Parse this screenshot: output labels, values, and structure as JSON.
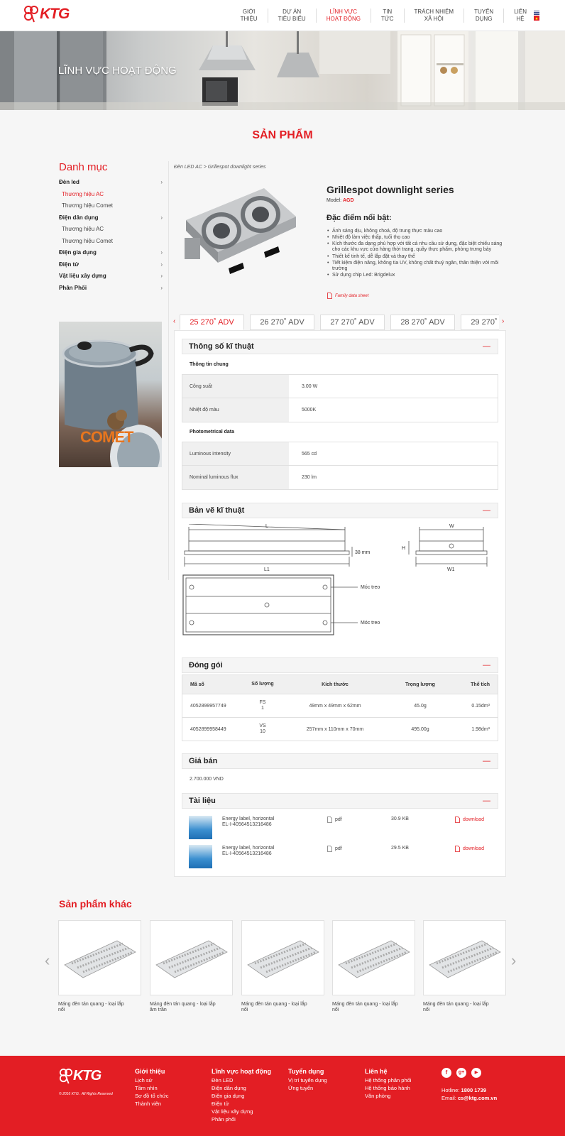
{
  "header": {
    "logo_text": "KTG",
    "nav": [
      {
        "l1": "GIỚI",
        "l2": "THIỆU"
      },
      {
        "l1": "DỰ ÁN",
        "l2": "TIÊU BIỂU"
      },
      {
        "l1": "LĨNH VỰC",
        "l2": "HOẠT ĐỘNG"
      },
      {
        "l1": "TIN",
        "l2": "TỨC"
      },
      {
        "l1": "TRÁCH NHIỆM",
        "l2": "XÃ HỘI"
      },
      {
        "l1": "TUYỂN",
        "l2": "DỤNG"
      },
      {
        "l1": "LIÊN",
        "l2": "HỆ"
      }
    ]
  },
  "hero": {
    "title": "LĨNH VỰC HOẠT ĐỘNG"
  },
  "section_title": "SẢN PHẨM",
  "sidebar": {
    "title": "Danh mục",
    "items": [
      {
        "label": "Đèn led",
        "type": "cat"
      },
      {
        "label": "Thương hiệu AC",
        "type": "sub",
        "active": true
      },
      {
        "label": "Thương hiệu Comet",
        "type": "sub"
      },
      {
        "label": "Điện dân dụng",
        "type": "cat"
      },
      {
        "label": "Thương hiệu AC",
        "type": "sub"
      },
      {
        "label": "Thương hiệu Comet",
        "type": "sub"
      },
      {
        "label": "Điện gia dụng",
        "type": "cat"
      },
      {
        "label": "Điện tử",
        "type": "cat"
      },
      {
        "label": "Vật liệu xây dựng",
        "type": "cat"
      },
      {
        "label": "Phân Phối",
        "type": "cat"
      }
    ],
    "promo_brand": "COMET"
  },
  "product": {
    "breadcrumb": "Đèn LED AC > Grillespot downlight series",
    "title": "Grillespot downlight series",
    "model_label": "Model:",
    "model_value": "AGD",
    "features_title": "Đặc điểm nổi bật:",
    "features": [
      "Ánh sáng dịu, không choá, độ trung thực màu cao",
      "Nhiệt độ làm việc thấp, tuổi thọ cao",
      "Kích thước đa dạng phù hợp với tất cả nhu cầu sử dụng, đặc biệt chiếu sáng cho các khu vực cửa hàng thời trang, quầy thực phẩm, phòng trưng bày",
      "Thiết kế tinh tế, dễ lắp đặt và thay thế",
      "Tiết kiệm điện năng, không tia UV, không chất thuỷ ngân, thân thiện với môi trường",
      "Sử dụng chip Led: Brigdelux"
    ],
    "datasheet_label": "Family data sheet"
  },
  "tabs": [
    {
      "label": "25 270˚ ADV",
      "active": true
    },
    {
      "label": "26 270˚ ADV"
    },
    {
      "label": "27 270˚ ADV"
    },
    {
      "label": "28 270˚ ADV"
    },
    {
      "label": "29 270˚ ADV"
    }
  ],
  "specs": {
    "title": "Thông số kĩ thuật",
    "general_title": "Thông tin chung",
    "general": [
      {
        "k": "Công suất",
        "v": "3.00 W"
      },
      {
        "k": "Nhiệt độ màu",
        "v": "5000K"
      }
    ],
    "photo_title": "Photometrical data",
    "photo": [
      {
        "k": "Luminous intensity",
        "v": "565 cd"
      },
      {
        "k": "Nominal luminous flux",
        "v": "230 lm"
      }
    ]
  },
  "drawing": {
    "title": "Bản vẽ kĩ thuật",
    "label_L": "L",
    "label_L1": "L1",
    "label_38": "38 mm",
    "label_W": "W",
    "label_W1": "W1",
    "label_H": "H",
    "label_hook1": "Móc treo",
    "label_hook2": "Móc treo"
  },
  "packaging": {
    "title": "Đóng gói",
    "headers": [
      "Mã số",
      "Số lượng",
      "Kích thước",
      "Trọng lượng",
      "Thể tích"
    ],
    "rows": [
      {
        "code": "4052899957749",
        "qty_unit": "FS",
        "qty": "1",
        "size": "49mm x 49mm x 62mm",
        "weight": "45.0g",
        "volume": "0.15dm³"
      },
      {
        "code": "4052899958449",
        "qty_unit": "VS",
        "qty": "10",
        "size": "257mm x 110mm x 70mm",
        "weight": "495.00g",
        "volume": "1.98dm³"
      }
    ]
  },
  "price": {
    "title": "Giá bán",
    "value": "2.700.000 VND"
  },
  "documents": {
    "title": "Tài liệu",
    "items": [
      {
        "line1": "Energy label, horizontal",
        "line2": "EL-I-40564513216486",
        "type": "pdf",
        "size": "30.9 KB",
        "download": "download"
      },
      {
        "line1": "Energy label, horizontal",
        "line2": "EL-I-40564513216486",
        "type": "pdf",
        "size": "29.5 KB",
        "download": "download"
      }
    ]
  },
  "other": {
    "title": "Sản phẩm khác",
    "items": [
      {
        "l1": "Máng đèn tán quang - loại lắp",
        "l2": "nổi"
      },
      {
        "l1": "Máng đèn tán quang - loại lắp",
        "l2": "âm trần"
      },
      {
        "l1": "Máng đèn tán quang - loại lắp",
        "l2": "nổi"
      },
      {
        "l1": "Máng đèn tán quang - loại lắp",
        "l2": "nổi"
      },
      {
        "l1": "Máng đèn tán quang - loại lắp",
        "l2": "nổi"
      }
    ]
  },
  "footer": {
    "logo_text": "KTG",
    "copyright": "© 2016 KTG . All Rights Reserved",
    "cols": [
      {
        "title": "Giới thiệu",
        "links": [
          "Lịch sử",
          "Tầm nhìn",
          "Sơ đồ tổ chức",
          "Thành viên"
        ]
      },
      {
        "title": "Lĩnh vực hoạt động",
        "links": [
          "Đèn LED",
          "Điện dân dụng",
          "Điện gia dụng",
          "Điện tử",
          "Vật liệu xây dựng",
          "Phân phối"
        ]
      },
      {
        "title": "Tuyển dụng",
        "links": [
          "Vị trí tuyển dụng",
          "Ứng tuyển"
        ]
      },
      {
        "title": "Liên hệ",
        "links": [
          "Hệ thống phân phối",
          "Hệ thống bảo hành",
          "Văn phòng"
        ]
      }
    ],
    "social": [
      "f",
      "g+",
      "▶"
    ],
    "hotline_label": "Hotline:",
    "hotline": "1800 1739",
    "email_label": "Email:",
    "email": "cs@ktg.com.vn"
  },
  "colors": {
    "brand": "#e31e24",
    "footer_bg": "#e31e24",
    "panel_bg": "#ffffff"
  }
}
